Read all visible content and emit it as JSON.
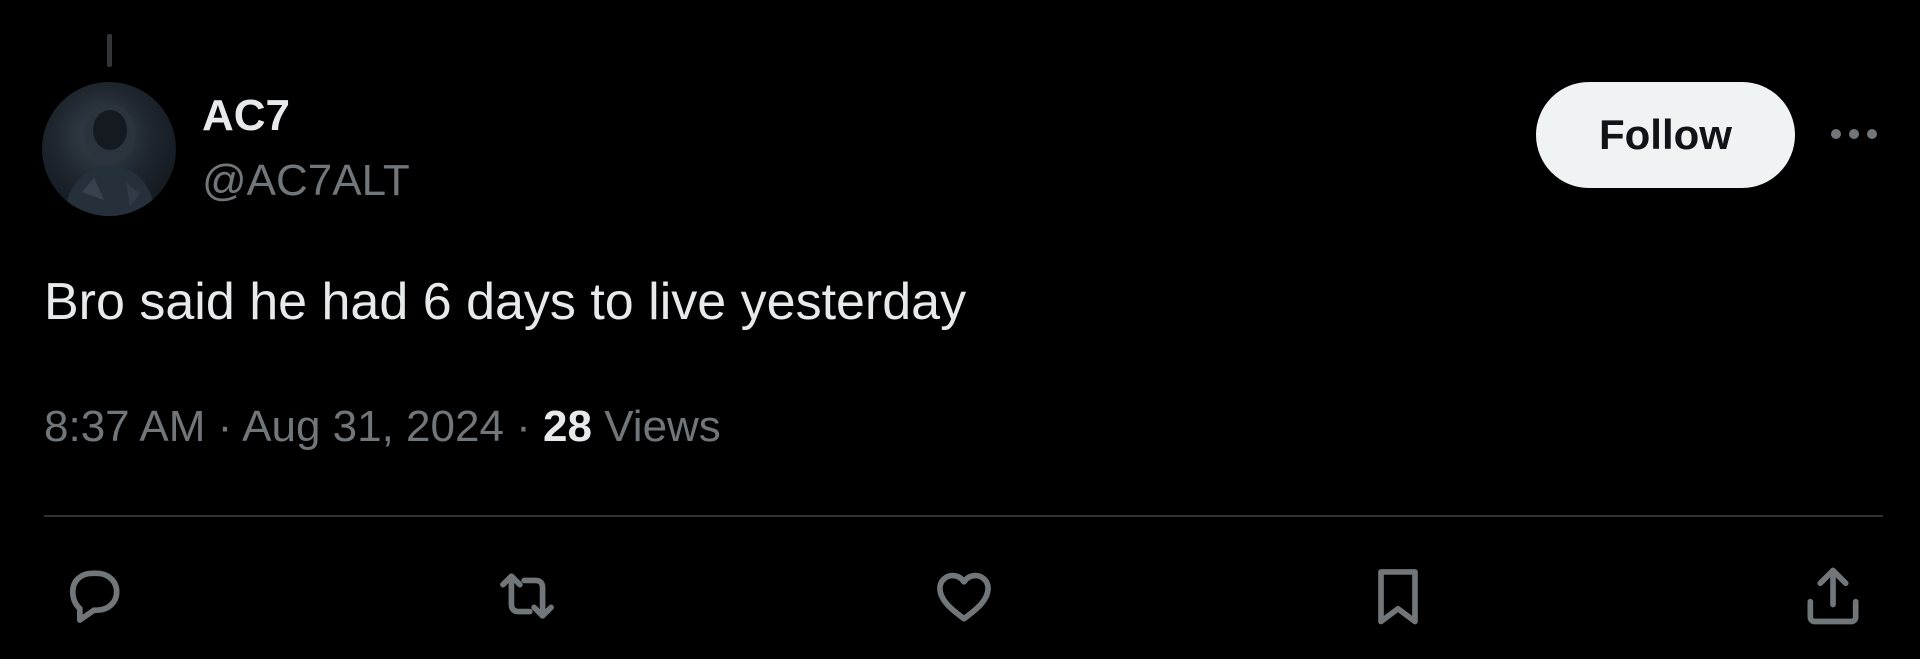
{
  "tweet": {
    "author": {
      "display_name": "AC7",
      "handle": "@AC7ALT",
      "avatar_icon": "user-avatar-icon"
    },
    "follow_label": "Follow",
    "more_icon": "more-options-icon",
    "text": "Bro said he had 6 days to live yesterday",
    "time": "8:37 AM",
    "separator": "·",
    "date": "Aug 31, 2024",
    "views_count": "28",
    "views_label": "Views"
  },
  "actions": {
    "reply_icon": "reply-icon",
    "retweet_icon": "retweet-icon",
    "like_icon": "heart-icon",
    "bookmark_icon": "bookmark-icon",
    "share_icon": "share-icon"
  },
  "colors": {
    "background": "#000000",
    "primary_text": "#e7e9ea",
    "secondary_text": "#71767b",
    "follow_button_bg": "#eff3f4",
    "follow_button_text": "#0f1419",
    "divider": "#2f3336"
  }
}
